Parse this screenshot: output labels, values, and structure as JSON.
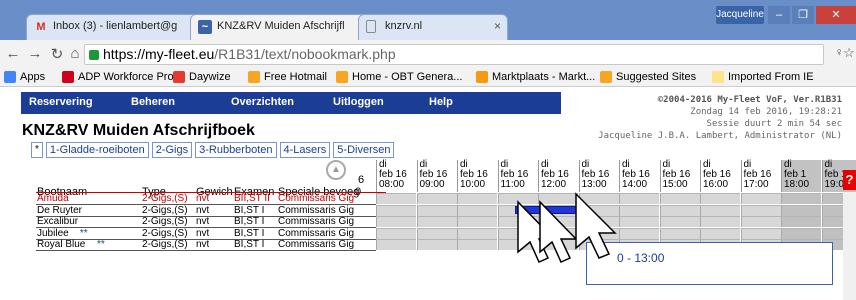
{
  "browser": {
    "tabs": [
      {
        "label": "Inbox (3) - lienlambert@g",
        "icon": "gmail-icon"
      },
      {
        "label": "KNZ&RV Muiden Afschrijfl",
        "icon": "fleet-icon"
      },
      {
        "label": "knzrv.nl",
        "icon": "page-icon"
      }
    ],
    "user": "Jacqueline",
    "url_host": "https://my-fleet.eu",
    "url_path": "/R1B31/text/nobookmark.php",
    "bookmarks": [
      {
        "label": "Apps",
        "color": "#4285f4"
      },
      {
        "label": "ADP Workforce Prof...",
        "color": "#d0021b"
      },
      {
        "label": "Daywize",
        "color": "#e53935"
      },
      {
        "label": "Free Hotmail",
        "color": "#f5a623"
      },
      {
        "label": "Home - OBT Genera...",
        "color": "#f5a623"
      },
      {
        "label": "Marktplaats - Markt...",
        "color": "#f39c12"
      },
      {
        "label": "Suggested Sites",
        "color": "#f5a623"
      },
      {
        "label": "Imported From IE",
        "color": "#ffe28a"
      }
    ]
  },
  "menu": [
    "Reservering",
    "Beheren",
    "Overzichten",
    "Uitloggen",
    "Help"
  ],
  "info": {
    "copyright": "©2004-2016 My-Fleet VoF, Ver.R1B31",
    "date": "Zondag 14 feb 2016, 19:28:21",
    "session": "Sessie duurt 2 min 54 sec",
    "user": "Jacqueline J.B.A. Lambert, Administrator (NL)"
  },
  "page_title": "KNZ&RV Muiden Afschrijfboek",
  "categories": [
    "1-Gladde-roeiboten",
    "2-Gigs",
    "3-Rubberboten",
    "4-Lasers",
    "5-Diversen"
  ],
  "columns": {
    "name": "Bootnaam",
    "type": "Type",
    "weight": "Gewich",
    "exam": "Examen",
    "special": "Speciale bevoeg"
  },
  "partial_col": "6",
  "partial_col2": "0",
  "hours": [
    {
      "d": "di",
      "date": "feb 16",
      "time": "08:00"
    },
    {
      "d": "di",
      "date": "feb 16",
      "time": "09:00"
    },
    {
      "d": "di",
      "date": "feb 16",
      "time": "10:00"
    },
    {
      "d": "di",
      "date": "feb 16",
      "time": "11:00"
    },
    {
      "d": "di",
      "date": "feb 16",
      "time": "12:00"
    },
    {
      "d": "di",
      "date": "feb 16",
      "time": "13:00"
    },
    {
      "d": "di",
      "date": "feb 16",
      "time": "14:00"
    },
    {
      "d": "di",
      "date": "feb 16",
      "time": "15:00"
    },
    {
      "d": "di",
      "date": "feb 16",
      "time": "16:00"
    },
    {
      "d": "di",
      "date": "feb 16",
      "time": "17:00"
    },
    {
      "d": "di",
      "date": "feb 1",
      "time": "18:00"
    },
    {
      "d": "di",
      "date": "feb 1",
      "time": "19:0"
    }
  ],
  "boats": [
    {
      "name": "Amuda",
      "stars": "",
      "type": "2-Gigs,(S)",
      "weight": "nvt",
      "exam": "BII,ST II",
      "special": "Commissaris Gig",
      "red": true
    },
    {
      "name": "De Ruyter",
      "stars": "",
      "type": "2-Gigs,(S)",
      "weight": "nvt",
      "exam": "BI,ST I",
      "special": "Commissaris Gig",
      "red": false
    },
    {
      "name": "Excalibur",
      "stars": "",
      "type": "2-Gigs,(S)",
      "weight": "nvt",
      "exam": "BI,ST I",
      "special": "Commissaris Gig",
      "red": false
    },
    {
      "name": "Jubilee",
      "stars": "**",
      "type": "2-Gigs,(S)",
      "weight": "nvt",
      "exam": "BI,ST I",
      "special": "Commissaris Gig",
      "red": false
    },
    {
      "name": "Royal Blue",
      "stars": "**",
      "type": "2-Gigs,(S)",
      "weight": "nvt",
      "exam": "BI,ST I",
      "special": "Commissaris Gig",
      "red": false
    }
  ],
  "tooltip": "0 - 13:00",
  "red_marker": "?",
  "colors": {
    "menu_bg": "#1c3d96",
    "booking": "#2036d6",
    "slot": "#d7d7d7",
    "amuda": "#cc0000",
    "link": "#1c3d96"
  }
}
